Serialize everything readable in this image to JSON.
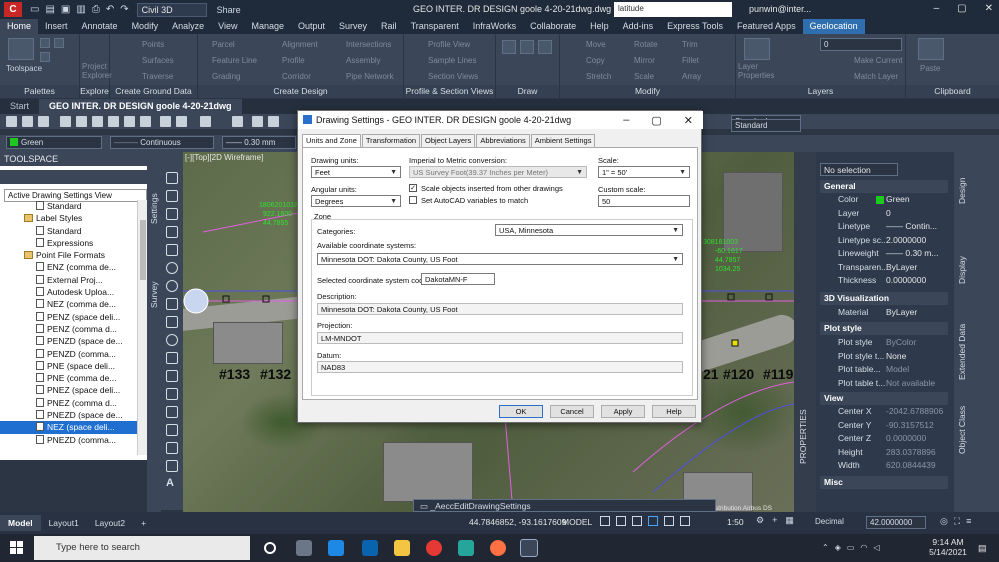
{
  "titlebar": {
    "workspace": "Civil 3D",
    "share": "Share",
    "title": "GEO INTER. DR DESIGN goole 4-20-21dwg.dwg",
    "search_placeholder": "latitude",
    "user": "punwin@inter..."
  },
  "ribbon_tabs": [
    "Home",
    "Insert",
    "Annotate",
    "Modify",
    "Analyze",
    "View",
    "Manage",
    "Output",
    "Survey",
    "Rail",
    "Transparent",
    "InfraWorks",
    "Collaborate",
    "Help",
    "Add-ins",
    "Express Tools",
    "Featured Apps",
    "Geolocation"
  ],
  "ribbon": {
    "toolspace": "Toolspace",
    "project_explorer": "Project Explorer",
    "points": "Points",
    "parcel": "Parcel",
    "alignment": "Alignment",
    "intersections": "Intersections",
    "profile_view": "Profile View",
    "move": "Move",
    "rotate": "Rotate",
    "trim": "Trim",
    "surfaces": "Surfaces",
    "feature_line": "Feature Line",
    "profile": "Profile",
    "assembly": "Assembly",
    "sample_lines": "Sample Lines",
    "copy": "Copy",
    "mirror": "Mirror",
    "fillet": "Fillet",
    "traverse": "Traverse",
    "grading": "Grading",
    "corridor": "Corridor",
    "pipe_network": "Pipe Network",
    "section_views": "Section Views",
    "stretch": "Stretch",
    "scale": "Scale",
    "array": "Array",
    "layer_properties": "Layer Properties",
    "make_current": "Make Current",
    "match_layer": "Match Layer",
    "paste": "Paste",
    "layer_value": "0",
    "groups": {
      "palettes": "Palettes",
      "explore": "Explore",
      "create_ground_data": "Create Ground Data",
      "create_design": "Create Design",
      "profile_section_views": "Profile & Section Views",
      "draw": "Draw",
      "modify": "Modify",
      "layers": "Layers",
      "clipboard": "Clipboard"
    }
  },
  "doc_tabs": {
    "start": "Start",
    "active": "GEO INTER. DR DESIGN goole 4-20-21dwg"
  },
  "toolbar": {
    "color": "Green",
    "linetype": "Continuous",
    "lineweight": "0.30 mm",
    "style1": "Standard",
    "style2": "Standard"
  },
  "toolspace": {
    "title": "TOOLSPACE",
    "view": "Active Drawing Settings View",
    "tree": [
      {
        "label": "Standard",
        "indent": 3,
        "icon": "style"
      },
      {
        "label": "Label Styles",
        "indent": 2,
        "icon": "folder"
      },
      {
        "label": "Standard",
        "indent": 3,
        "icon": "style"
      },
      {
        "label": "Expressions",
        "indent": 3,
        "icon": "doc"
      },
      {
        "label": "Point File Formats",
        "indent": 2,
        "icon": "folder"
      },
      {
        "label": "ENZ (comma de...",
        "indent": 3,
        "icon": "doc"
      },
      {
        "label": "External Proj...",
        "indent": 3,
        "icon": "doc"
      },
      {
        "label": "Autodesk Uploa...",
        "indent": 3,
        "icon": "doc"
      },
      {
        "label": "NEZ (comma de...",
        "indent": 3,
        "icon": "doc"
      },
      {
        "label": "PENZ (space deli...",
        "indent": 3,
        "icon": "doc"
      },
      {
        "label": "PENZ (comma d...",
        "indent": 3,
        "icon": "doc"
      },
      {
        "label": "PENZD (space de...",
        "indent": 3,
        "icon": "doc"
      },
      {
        "label": "PENZD (comma...",
        "indent": 3,
        "icon": "doc"
      },
      {
        "label": "PNE (space deli...",
        "indent": 3,
        "icon": "doc"
      },
      {
        "label": "PNE (comma de...",
        "indent": 3,
        "icon": "doc"
      },
      {
        "label": "PNEZ (space deli...",
        "indent": 3,
        "icon": "doc"
      },
      {
        "label": "PNEZ (comma d...",
        "indent": 3,
        "icon": "doc"
      },
      {
        "label": "PNEZD (space de...",
        "indent": 3,
        "icon": "doc"
      },
      {
        "label": "NEZ (space deli...",
        "indent": 3,
        "icon": "doc",
        "selected": true
      },
      {
        "label": "PNEZD (comma...",
        "indent": 3,
        "icon": "doc"
      }
    ]
  },
  "palette_strip": {
    "settings": "Settings",
    "survey": "Survey"
  },
  "viewport": {
    "controls": "[-][Top][2D Wireframe]",
    "lot_labels": [
      "#133",
      "#132",
      "21",
      "#120",
      "#119"
    ],
    "credits": "© 2021 Microsoft Corporation © 2021 Maxar ©CNES (2021) Distribution Airbus DS",
    "command": "_AeccEditDrawingSettings"
  },
  "dialog": {
    "title": "Drawing Settings - GEO INTER. DR DESIGN goole 4-20-21dwg",
    "tabs": [
      "Units and Zone",
      "Transformation",
      "Object Layers",
      "Abbreviations",
      "Ambient Settings"
    ],
    "drawing_units_label": "Drawing units:",
    "drawing_units": "Feet",
    "imperial_label": "Imperial to Metric conversion:",
    "imperial": "US Survey Foot(39.37 Inches per Meter)",
    "scale_label": "Scale:",
    "scale": "1\" = 50'",
    "angular_label": "Angular units:",
    "angular": "Degrees",
    "scale_objects": "Scale objects inserted from other drawings",
    "set_autocad": "Set AutoCAD variables to match",
    "custom_scale_label": "Custom scale:",
    "custom_scale": "50",
    "zone_label": "Zone",
    "categories_label": "Categories:",
    "categories": "USA, Minnesota",
    "available_label": "Available coordinate systems:",
    "available": "Minnesota DOT: Dakota County, US Foot",
    "code_label": "Selected coordinate system code:",
    "code": "DakotaMN-F",
    "description_label": "Description:",
    "description": "Minnesota DOT: Dakota County, US Foot",
    "projection_label": "Projection:",
    "projection": "LM-MNDOT",
    "datum_label": "Datum:",
    "datum": "NAD83",
    "buttons": {
      "ok": "OK",
      "cancel": "Cancel",
      "apply": "Apply",
      "help": "Help"
    }
  },
  "properties": {
    "selection": "No selection",
    "sections": {
      "general": "General",
      "viz3d": "3D Visualization",
      "plot_style": "Plot style",
      "view": "View",
      "misc": "Misc"
    },
    "general": [
      {
        "k": "Color",
        "v": "Green"
      },
      {
        "k": "Layer",
        "v": "0"
      },
      {
        "k": "Linetype",
        "v": "—— Contin..."
      },
      {
        "k": "Linetype sc...",
        "v": "2.0000000"
      },
      {
        "k": "Lineweight",
        "v": "—— 0.30 m..."
      },
      {
        "k": "Transparen...",
        "v": "ByLayer"
      },
      {
        "k": "Thickness",
        "v": "0.0000000"
      }
    ],
    "material_k": "Material",
    "material_v": "ByLayer",
    "plot": [
      {
        "k": "Plot style",
        "v": "ByColor",
        "dim": true
      },
      {
        "k": "Plot style t...",
        "v": "None",
        "dim": false
      },
      {
        "k": "Plot table...",
        "v": "Model",
        "dim": true
      },
      {
        "k": "Plot table t...",
        "v": "Not available",
        "dim": true
      }
    ],
    "view": [
      {
        "k": "Center X",
        "v": "-2042.6788906",
        "dim": true
      },
      {
        "k": "Center Y",
        "v": "-90.3157512",
        "dim": true
      },
      {
        "k": "Center Z",
        "v": "0.0000000",
        "dim": true
      },
      {
        "k": "Height",
        "v": "283.0378896",
        "dim": true
      },
      {
        "k": "Width",
        "v": "620.0844439",
        "dim": true
      }
    ],
    "strips": {
      "properties": "PROPERTIES",
      "design": "Design",
      "display": "Display",
      "extended": "Extended Data",
      "object_class": "Object Class"
    }
  },
  "status": {
    "tabs": [
      "Model",
      "Layout1",
      "Layout2"
    ],
    "coords": "44.7846852, -93.1617609",
    "model": "MODEL",
    "scale": "1:50",
    "decimal": "Decimal",
    "elevation": "42.0000000"
  },
  "taskbar": {
    "search": "Type here to search",
    "time": "9:14 AM",
    "date": "5/14/2021"
  }
}
